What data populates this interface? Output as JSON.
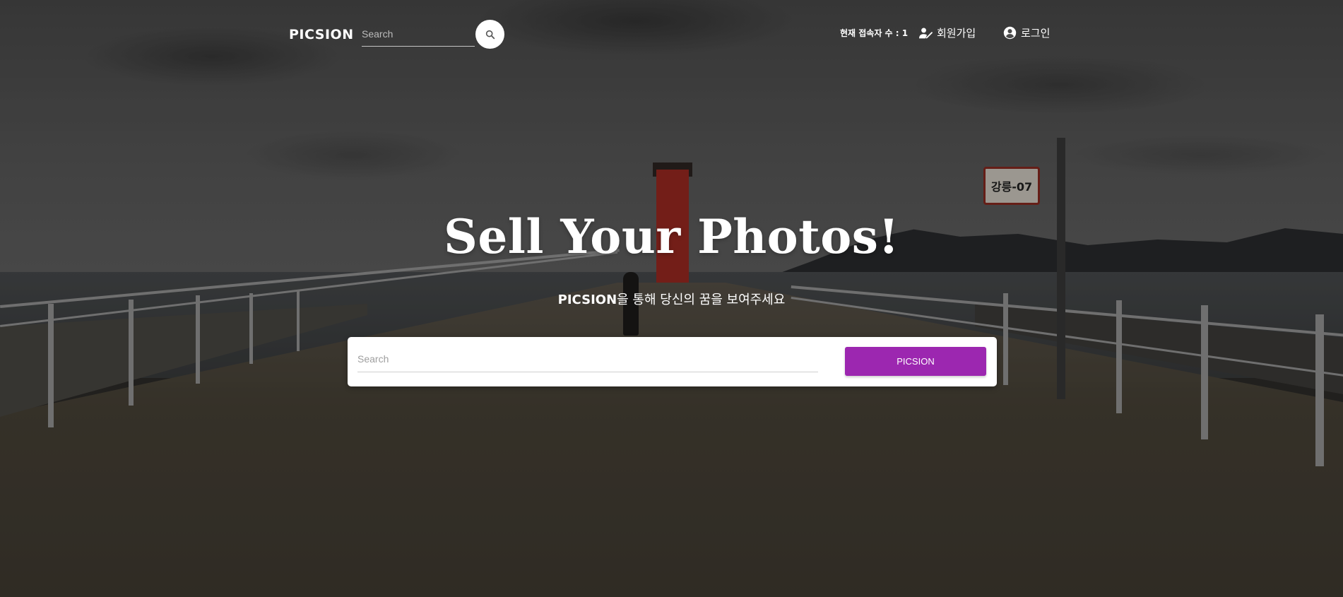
{
  "header": {
    "logo": "PICSION",
    "search_placeholder": "Search",
    "visitor_label": "현재 접속자 수 : ",
    "visitor_count": "1",
    "signup_label": "회원가입",
    "login_label": "로그인"
  },
  "hero": {
    "title": "Sell Your Photos!",
    "subtitle_brand": "PICSION",
    "subtitle_rest": "을 통해 당신의 꿈을 보여주세요",
    "search_placeholder": "Search",
    "search_button": "PICSION",
    "button_color": "#9c27b0"
  },
  "background": {
    "sign_text": "강릉-07"
  }
}
